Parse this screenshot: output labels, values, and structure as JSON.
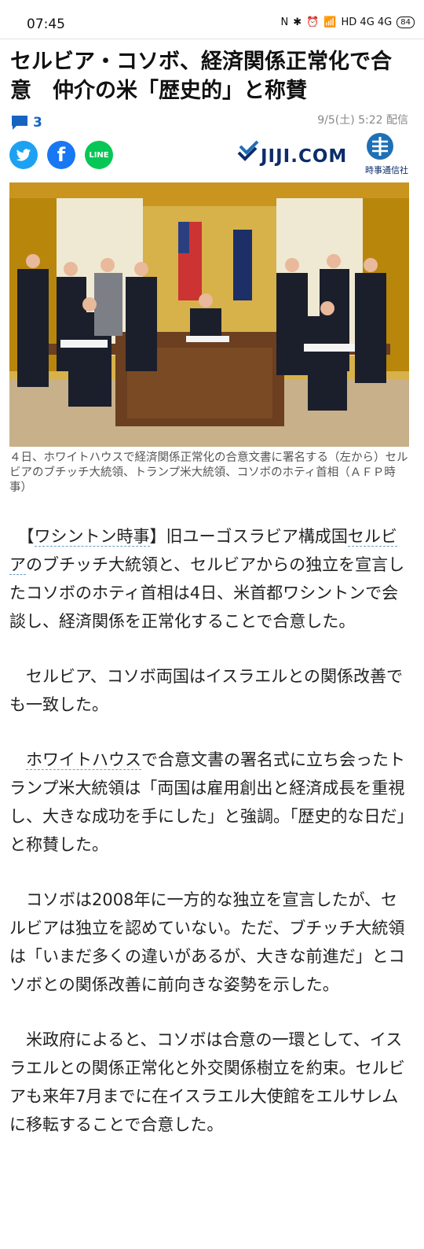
{
  "status": {
    "time": "07:45",
    "battery": "84",
    "network": "HD 4G 4G"
  },
  "article": {
    "headline": "セルビア・コソボ、経済関係正常化で合意　仲介の米「歴史的」と称賛",
    "comment_count": "3",
    "date": "9/5(土) 5:22 配信",
    "share": {
      "line_label": "LINE"
    },
    "source_logo": {
      "name": "JIJI.COM",
      "sub": "時事通信社"
    },
    "caption": "４日、ホワイトハウスで経済関係正常化の合意文書に署名する（左から）セルビアのブチッチ大統領、トランプ米大統領、コソボのホティ首相（ＡＦＰ時事）",
    "p1": {
      "a": "【",
      "link1": "ワシントン時事",
      "b": "】旧ユーゴスラビア構成国",
      "link2": "セルビア",
      "c": "のブチッチ大統領と、セルビアからの独立を宣言したコソボのホティ首相は4日、米首都ワシントンで会談し、経済関係を正常化することで合意した。"
    },
    "p2": "セルビア、コソボ両国はイスラエルとの関係改善でも一致した。",
    "p3": {
      "link": "ホワイトハウス",
      "rest": "で合意文書の署名式に立ち会ったトランプ米大統領は「両国は雇用創出と経済成長を重視し、大きな成功を手にした」と強調。「歴史的な日だ」と称賛した。"
    },
    "p4": "コソボは2008年に一方的な独立を宣言したが、セルビアは独立を認めていない。ただ、ブチッチ大統領は「いまだ多くの違いがあるが、大きな前進だ」とコソボとの関係改善に前向きな姿勢を示した。",
    "p5": "米政府によると、コソボは合意の一環として、イスラエルとの関係正常化と外交関係樹立を約束。セルビアも来年7月までに在イスラエル大使館をエルサレムに移転することで合意した。"
  },
  "colors": {
    "link": "#1565c0",
    "logo": "#0d2c6b",
    "twitter": "#1da1f2",
    "facebook": "#1877f2",
    "line": "#06c755"
  }
}
